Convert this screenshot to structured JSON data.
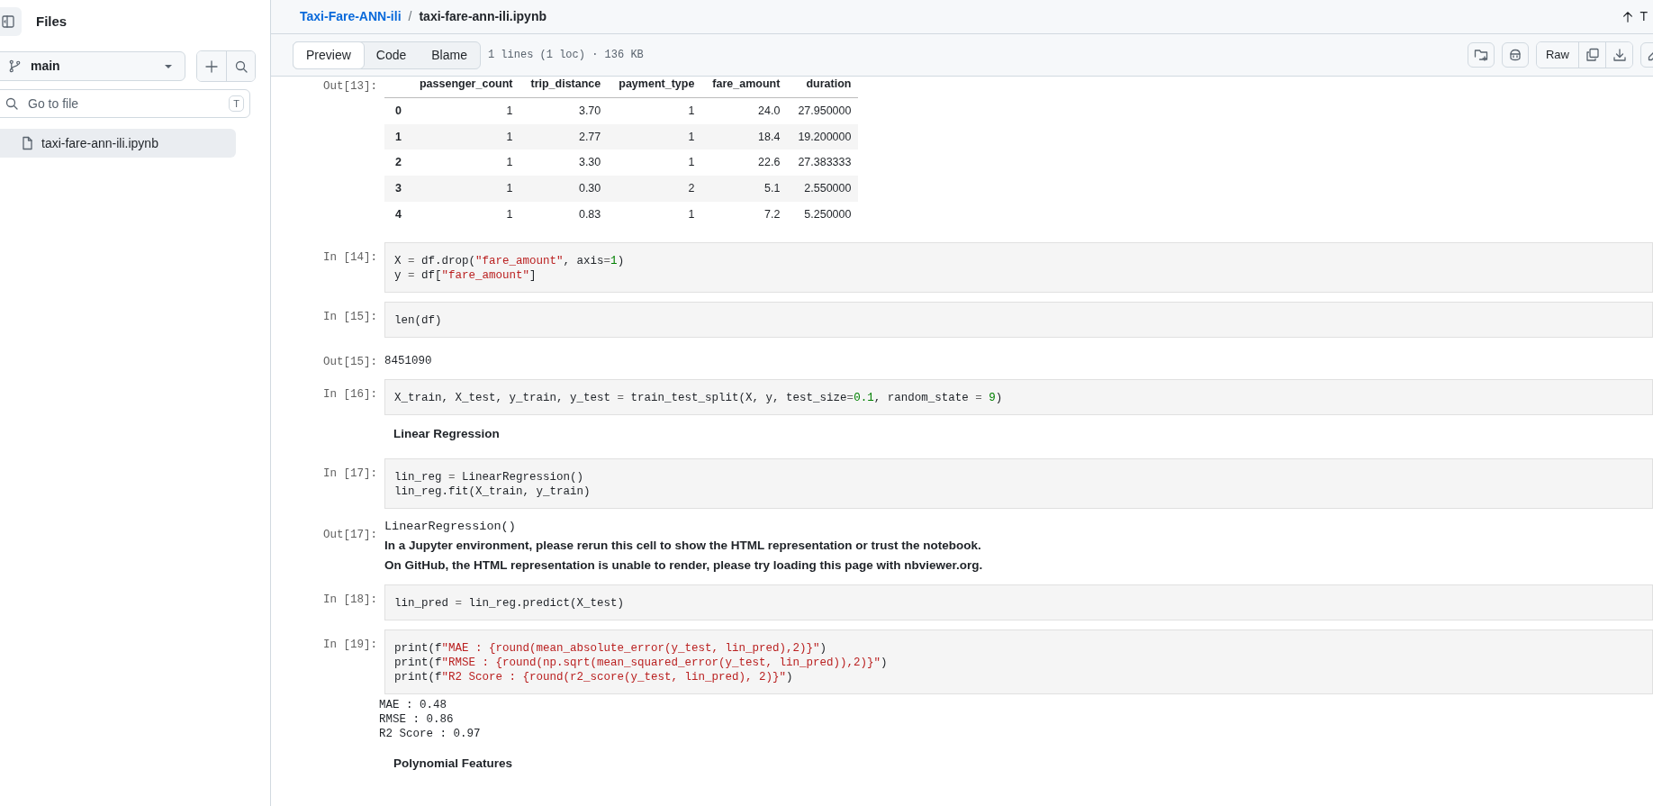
{
  "sidebar": {
    "title": "Files",
    "branch": "main",
    "search": {
      "placeholder": "Go to file",
      "shortcut": "T"
    },
    "files": [
      {
        "name": "taxi-fare-ann-ili.ipynb",
        "selected": true
      }
    ]
  },
  "header": {
    "breadcrumb": [
      "Taxi-Fare-ANN-ili",
      "taxi-fare-ann-ili.ipynb"
    ],
    "separator": "/",
    "top_link": "T"
  },
  "toolbar": {
    "tabs": [
      {
        "label": "Preview",
        "selected": true
      },
      {
        "label": "Code",
        "selected": false
      },
      {
        "label": "Blame",
        "selected": false
      }
    ],
    "info": "1 lines (1 loc) · 136 KB",
    "raw": "Raw"
  },
  "cells": [
    {
      "kind": "dataframe",
      "prompt": "Out[13]:",
      "columns": [
        "passenger_count",
        "trip_distance",
        "payment_type",
        "fare_amount",
        "duration"
      ],
      "rows": [
        {
          "index": "0",
          "values": [
            "1",
            "3.70",
            "1",
            "24.0",
            "27.950000"
          ]
        },
        {
          "index": "1",
          "values": [
            "1",
            "2.77",
            "1",
            "18.4",
            "19.200000"
          ]
        },
        {
          "index": "2",
          "values": [
            "1",
            "3.30",
            "1",
            "22.6",
            "27.383333"
          ]
        },
        {
          "index": "3",
          "values": [
            "1",
            "0.30",
            "2",
            "5.1",
            "2.550000"
          ]
        },
        {
          "index": "4",
          "values": [
            "1",
            "0.83",
            "1",
            "7.2",
            "5.250000"
          ]
        }
      ]
    },
    {
      "kind": "code",
      "prompt": "In [14]:",
      "lines": [
        "X = df.drop(\"fare_amount\", axis=1)",
        "y = df[\"fare_amount\"]"
      ]
    },
    {
      "kind": "code",
      "prompt": "In [15]:",
      "lines": [
        "len(df)"
      ]
    },
    {
      "kind": "output",
      "prompt": "Out[15]:",
      "lines": [
        "8451090"
      ]
    },
    {
      "kind": "code",
      "prompt": "In [16]:",
      "lines": [
        "X_train, X_test, y_train, y_test = train_test_split(X, y, test_size=0.1, random_state = 9)"
      ]
    },
    {
      "kind": "markdown",
      "text": "Linear Regression"
    },
    {
      "kind": "code",
      "prompt": "In [17]:",
      "lines": [
        "lin_reg = LinearRegression()",
        "lin_reg.fit(X_train, y_train)"
      ]
    },
    {
      "kind": "repr",
      "prompt": "Out[17]:",
      "repr": "LinearRegression()",
      "notes": [
        "In a Jupyter environment, please rerun this cell to show the HTML representation or trust the notebook.",
        "On GitHub, the HTML representation is unable to render, please try loading this page with nbviewer.org."
      ]
    },
    {
      "kind": "code",
      "prompt": "In [18]:",
      "lines": [
        "lin_pred = lin_reg.predict(X_test)"
      ]
    },
    {
      "kind": "code",
      "prompt": "In [19]:",
      "lines": [
        "print(f\"MAE : {round(mean_absolute_error(y_test, lin_pred),2)}\")",
        "print(f\"RMSE : {round(np.sqrt(mean_squared_error(y_test, lin_pred)),2)}\")",
        "print(f\"R2 Score : {round(r2_score(y_test, lin_pred), 2)}\")"
      ]
    },
    {
      "kind": "stream",
      "lines": [
        "MAE : 0.48",
        "RMSE : 0.86",
        "R2 Score : 0.97"
      ]
    },
    {
      "kind": "markdown",
      "text": "Polynomial Features"
    }
  ]
}
